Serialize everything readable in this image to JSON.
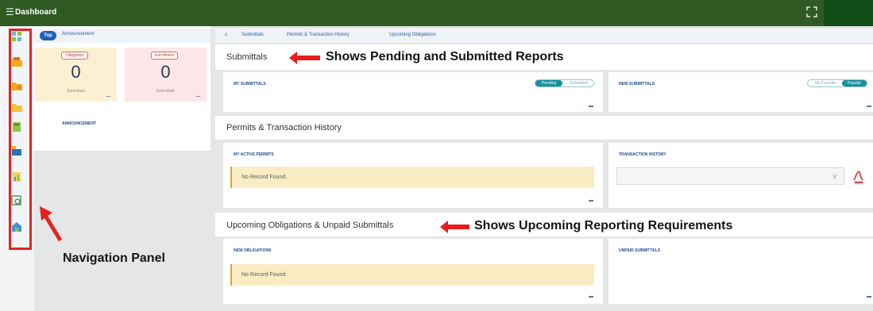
{
  "header": {
    "title": "Dashboard"
  },
  "left": {
    "tabs": {
      "top": "Top",
      "announcement": "Announcement"
    },
    "cards": [
      {
        "badge": "Obligation",
        "count": "0",
        "sub": "Submittals"
      },
      {
        "badge": "Enrollment",
        "count": "0",
        "sub": "Submittals"
      }
    ],
    "announcement_label": "ANNOUNCEMENT"
  },
  "breadcrumb": [
    "Submittals",
    "Permits & Transaction History",
    "Upcoming Obligations"
  ],
  "sections": {
    "submittals": "Submittals",
    "permits": "Permits & Transaction History",
    "upcoming": "Upcoming Obligations & Unpaid Submittals"
  },
  "panels": {
    "my_submittals": {
      "label": "MY SUBMITTALS",
      "toggle_on": "Pending",
      "toggle_off": "Submitted"
    },
    "new_submittals": {
      "label": "NEW SUBMITTALS",
      "toggle_off": "My Favorite",
      "toggle_on": "Popular"
    },
    "my_active_permits": {
      "label": "MY ACTIVE PERMITS",
      "empty": "No Record Found."
    },
    "transaction_history": {
      "label": "TRANSACTION HISTORY"
    },
    "new_obligations": {
      "label": "NEW OBLIGATIONS",
      "empty": "No Record Found."
    },
    "unpaid_submittals": {
      "label": "UNPAID SUBMITTALS"
    }
  },
  "annotations": {
    "submittals": "Shows Pending and Submitted Reports",
    "upcoming": "Shows Upcoming Reporting Requirements",
    "nav": "Navigation Panel"
  },
  "nav_icons": [
    "dashboard-icon",
    "folder-icon",
    "folder-icon",
    "folder-icon",
    "report-icon",
    "map-icon",
    "chart-icon",
    "search-icon",
    "building-icon"
  ],
  "colors": {
    "header": "#2f5a24",
    "accent_blue": "#1f5fbd",
    "teal": "#1a8fa0",
    "annotation_red": "#e42320"
  }
}
